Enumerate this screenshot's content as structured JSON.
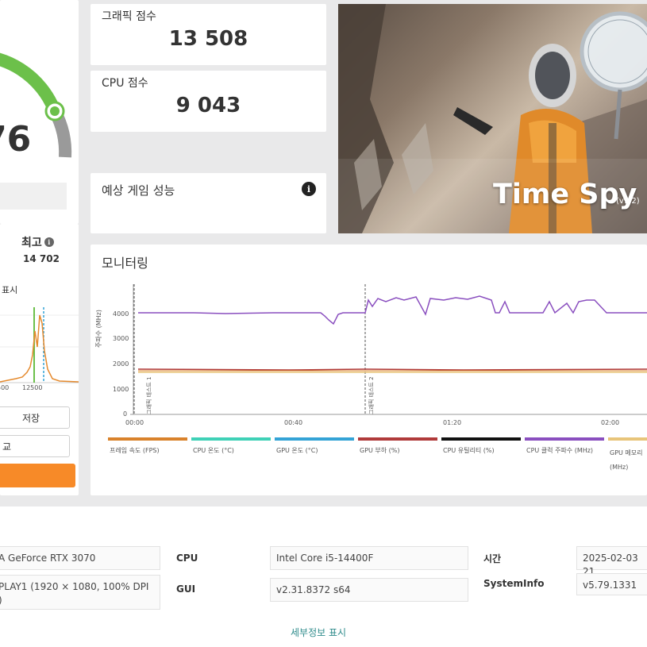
{
  "left_panel": {
    "main_score_partial": "76",
    "best_label": "최고",
    "best_value": "14 702",
    "histogram_label": "표시",
    "histogram_tick": "12500",
    "histogram_tick_left": "500",
    "save_label": "저장",
    "compare_label": "교"
  },
  "scores": {
    "graphics_label": "그래픽 점수",
    "graphics_value": "13 508",
    "cpu_label": "CPU 점수",
    "cpu_value": "9 043",
    "game_perf_label": "예상 게임 성능"
  },
  "hero": {
    "title": "Time Spy",
    "version": "(v1.2)"
  },
  "monitoring": {
    "title": "모니터링",
    "y_axis_label": "주파수 (MHz)",
    "y_ticks": [
      "4000",
      "3000",
      "2000",
      "1000",
      "0"
    ],
    "x_ticks": [
      "00:00",
      "00:40",
      "01:20",
      "02:00"
    ],
    "marker_labels": [
      "그래픽 테스트 1",
      "그래픽 테스트 2"
    ],
    "legend": [
      {
        "label": "프레임 속도 (FPS)",
        "color": "#d9822b"
      },
      {
        "label": "CPU 온도 (°C)",
        "color": "#3fd1b7"
      },
      {
        "label": "GPU 온도 (°C)",
        "color": "#34a3d6"
      },
      {
        "label": "GPU 부하 (%)",
        "color": "#b03a3a"
      },
      {
        "label": "CPU 유틸리티 (%)",
        "color": "#111111"
      },
      {
        "label": "CPU 클럭 주파수 (MHz)",
        "color": "#8a4fbf"
      },
      {
        "label": "GPU 메모리 (MHz)",
        "color": "#e8c57a"
      }
    ]
  },
  "chart_data": {
    "type": "line",
    "title": "모니터링",
    "ylabel": "주파수 (MHz)",
    "ylim": [
      0,
      5000
    ],
    "x": [
      "00:00",
      "00:40",
      "01:20",
      "02:00"
    ],
    "series": [
      {
        "name": "CPU 클럭 주파수 (MHz)",
        "values_by_segment": [
          4100,
          4100,
          3650,
          4600,
          4600,
          4100,
          4100
        ]
      },
      {
        "name": "GPU 부하 (%)",
        "values_by_segment": [
          1800,
          1800,
          1800,
          1800
        ]
      },
      {
        "name": "GPU 메모리 (MHz)",
        "values_by_segment": [
          1700,
          1700,
          1700,
          1700
        ]
      }
    ]
  },
  "system_info": {
    "gpu_value": "A GeForce RTX 3070",
    "display_value": "PLAY1 (1920 × 1080, 100% DPI )",
    "cpu_key": "CPU",
    "cpu_value": "Intel Core i5-14400F",
    "gui_key": "GUI",
    "gui_value": "v2.31.8372 s64",
    "time_key": "시간",
    "time_value": "2025-02-03 21",
    "sysinfo_key": "SystemInfo",
    "sysinfo_value": "v5.79.1331",
    "details_link": "세부정보 표시"
  },
  "colors": {
    "gauge_green": "#6cc04a",
    "accent_orange": "#f78a28",
    "link_teal": "#2e8b8b"
  }
}
